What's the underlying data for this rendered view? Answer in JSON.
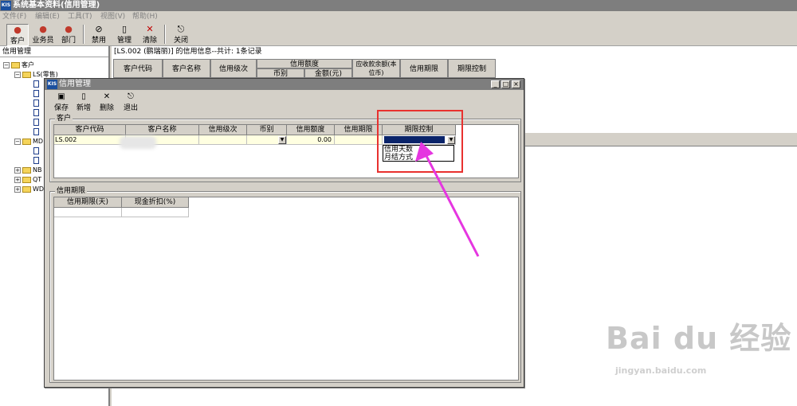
{
  "main_window": {
    "title": "系统基本资料(信用管理)",
    "icon_label": "KIS"
  },
  "menu": [
    "文件(F)",
    "编辑(E)",
    "工具(T)",
    "视图(V)",
    "帮助(H)"
  ],
  "toolbar": {
    "customer": "客户",
    "salesman": "业务员",
    "department": "部门",
    "disable": "禁用",
    "manage": "管理",
    "clear": "清除",
    "close": "关闭"
  },
  "tree": {
    "title": "信用管理",
    "root": "客户",
    "ls_group": "LS(零售)",
    "md": "MD",
    "nb": "NB",
    "qt": "QT",
    "wd": "WD"
  },
  "background": {
    "info_text": "[LS.002 (鹏瑞丽)] 的信用信息--共计: 1条记录",
    "columns": [
      "客户代码",
      "客户名称",
      "信用级次",
      "信用额度",
      "币别",
      "金额(元)",
      "应收款余额(本位币)",
      "信用期限",
      "期限控制"
    ]
  },
  "child_window": {
    "title": "信用管理",
    "icon_label": "KIS",
    "toolbar": {
      "save": "保存",
      "new": "新增",
      "delete": "删除",
      "exit": "退出"
    },
    "customer_group": {
      "label": "客户",
      "columns": [
        "客户代码",
        "客户名称",
        "信用级次",
        "币别",
        "信用额度",
        "信用期限",
        "期限控制"
      ],
      "row": {
        "code": "LS.002",
        "credit_amount": "0.00"
      }
    },
    "dropdown_options": [
      "信用天数",
      "月结方式"
    ],
    "term_group": {
      "label": "信用期限",
      "columns": [
        "信用期限(天)",
        "现金折扣(%)"
      ]
    }
  },
  "watermark": {
    "logo": "Bai du 经验",
    "url": "jingyan.baidu.com"
  },
  "colors": {
    "title_bar": "#7e7e7e",
    "highlight": "#e8312f",
    "arrow": "#e536e0",
    "selection": "#0a246a"
  }
}
